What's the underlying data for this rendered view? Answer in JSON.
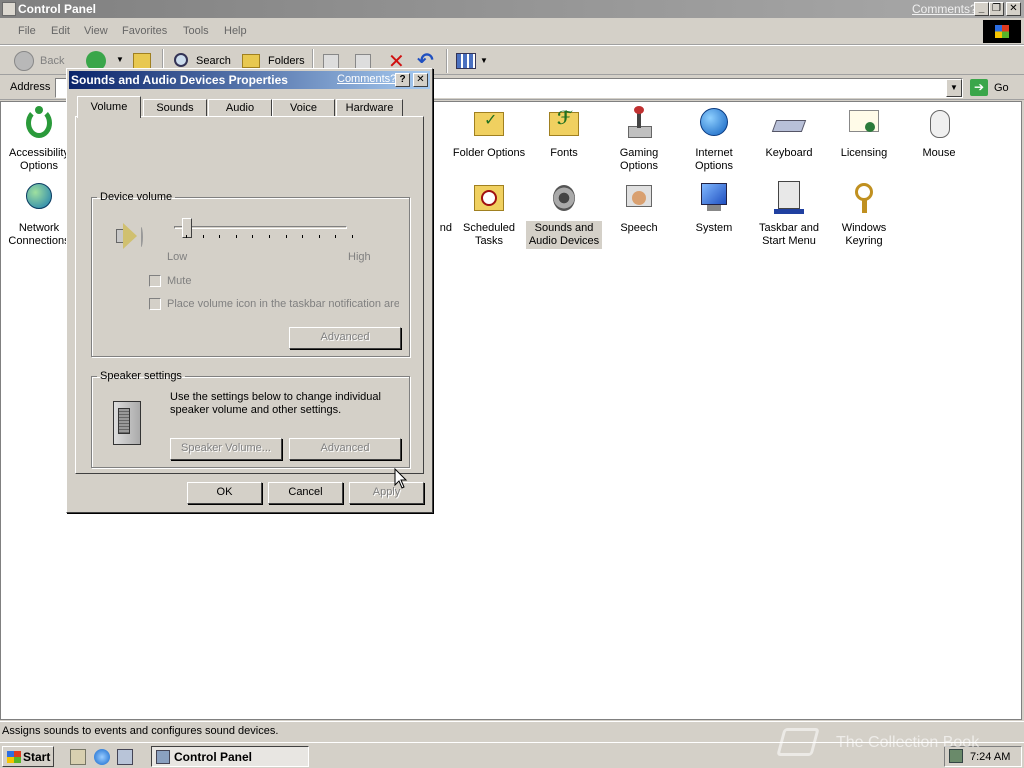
{
  "window": {
    "title": "Control Panel",
    "comments_link": "Comments?"
  },
  "menu": [
    "File",
    "Edit",
    "View",
    "Favorites",
    "Tools",
    "Help"
  ],
  "toolbar": {
    "back": "Back",
    "search": "Search",
    "folders": "Folders"
  },
  "address": {
    "label": "Address",
    "go": "Go"
  },
  "icons": [
    {
      "name": "accessibility",
      "label": "Accessibility Options"
    },
    {
      "name": "folder-options",
      "label": "Folder Options"
    },
    {
      "name": "fonts",
      "label": "Fonts"
    },
    {
      "name": "gaming-options",
      "label": "Gaming Options"
    },
    {
      "name": "internet-options",
      "label": "Internet Options"
    },
    {
      "name": "keyboard",
      "label": "Keyboard"
    },
    {
      "name": "licensing",
      "label": "Licensing"
    },
    {
      "name": "mouse",
      "label": "Mouse"
    },
    {
      "name": "network-connections",
      "label": "Network Connections"
    },
    {
      "name": "partial",
      "label": "nd"
    },
    {
      "name": "scheduled-tasks",
      "label": "Scheduled Tasks"
    },
    {
      "name": "sounds-audio",
      "label": "Sounds and Audio Devices"
    },
    {
      "name": "speech",
      "label": "Speech"
    },
    {
      "name": "system",
      "label": "System"
    },
    {
      "name": "taskbar-start-menu",
      "label": "Taskbar and Start Menu"
    },
    {
      "name": "windows-keyring",
      "label": "Windows Keyring"
    }
  ],
  "dialog": {
    "title": "Sounds and Audio Devices Properties",
    "comments": "Comments?",
    "help": "?",
    "close": "✕",
    "tabs": [
      "Volume",
      "Sounds",
      "Audio",
      "Voice",
      "Hardware"
    ],
    "active_tab": "Volume",
    "device_volume": {
      "legend": "Device volume",
      "low": "Low",
      "high": "High",
      "slider_value": 0,
      "mute": "Mute",
      "place_icon": "Place volume icon in the taskbar notification area",
      "advanced": "Advanced"
    },
    "speaker": {
      "legend": "Speaker settings",
      "text": "Use the settings below to change individual speaker volume and other settings.",
      "speaker_volume": "Speaker Volume...",
      "advanced": "Advanced"
    },
    "buttons": {
      "ok": "OK",
      "cancel": "Cancel",
      "apply": "Apply"
    }
  },
  "status": "Assigns sounds to events and configures sound devices.",
  "taskbar": {
    "start": "Start",
    "task": "Control Panel",
    "clock": "7:24 AM"
  },
  "watermark": "The Collection Book"
}
